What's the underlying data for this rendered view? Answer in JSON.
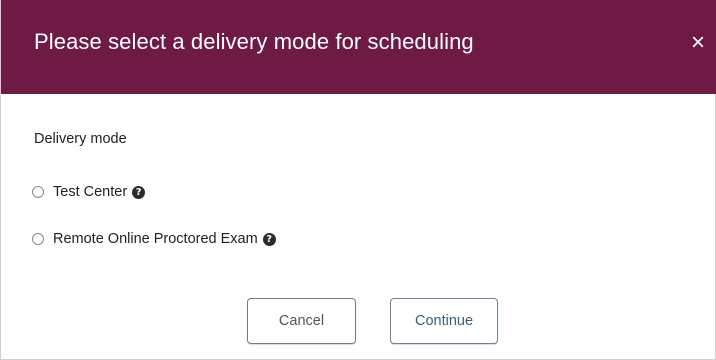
{
  "dialog": {
    "title": "Please select a delivery mode for scheduling",
    "close_label": "×",
    "header_color": "#6e1a44"
  },
  "form": {
    "section_label": "Delivery mode",
    "options": [
      {
        "label": "Test Center",
        "selected": false,
        "help_icon": "question-circle-icon"
      },
      {
        "label": "Remote Online Proctored Exam",
        "selected": false,
        "help_icon": "question-circle-icon"
      }
    ]
  },
  "actions": {
    "cancel_label": "Cancel",
    "continue_label": "Continue"
  },
  "icons": {
    "help_glyph": "?"
  }
}
